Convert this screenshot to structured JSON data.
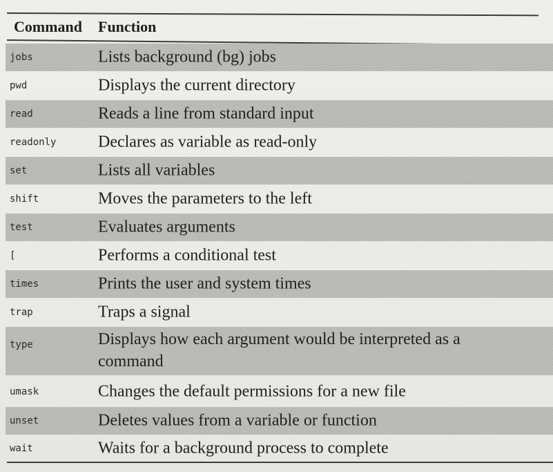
{
  "table": {
    "header": {
      "command": "Command",
      "function": "Function"
    },
    "rows": [
      {
        "command": "jobs",
        "function": "Lists background (bg) jobs"
      },
      {
        "command": "pwd",
        "function": "Displays the current directory"
      },
      {
        "command": "read",
        "function": "Reads a line from standard input"
      },
      {
        "command": "readonly",
        "function": "Declares as variable as read-only"
      },
      {
        "command": "set",
        "function": "Lists all variables"
      },
      {
        "command": "shift",
        "function": "Moves the parameters to the left"
      },
      {
        "command": "test",
        "function": "Evaluates arguments"
      },
      {
        "command": "[",
        "function": "Performs a conditional test"
      },
      {
        "command": "times",
        "function": "Prints the user and system times"
      },
      {
        "command": "trap",
        "function": "Traps a signal"
      },
      {
        "command": "type",
        "function": "Displays how each argument would be interpreted as a command"
      },
      {
        "command": "umask",
        "function": "Changes the default permissions for a new file"
      },
      {
        "command": "unset",
        "function": "Deletes values from a variable or function"
      },
      {
        "command": "wait",
        "function": "Waits for a background process to complete"
      }
    ]
  }
}
